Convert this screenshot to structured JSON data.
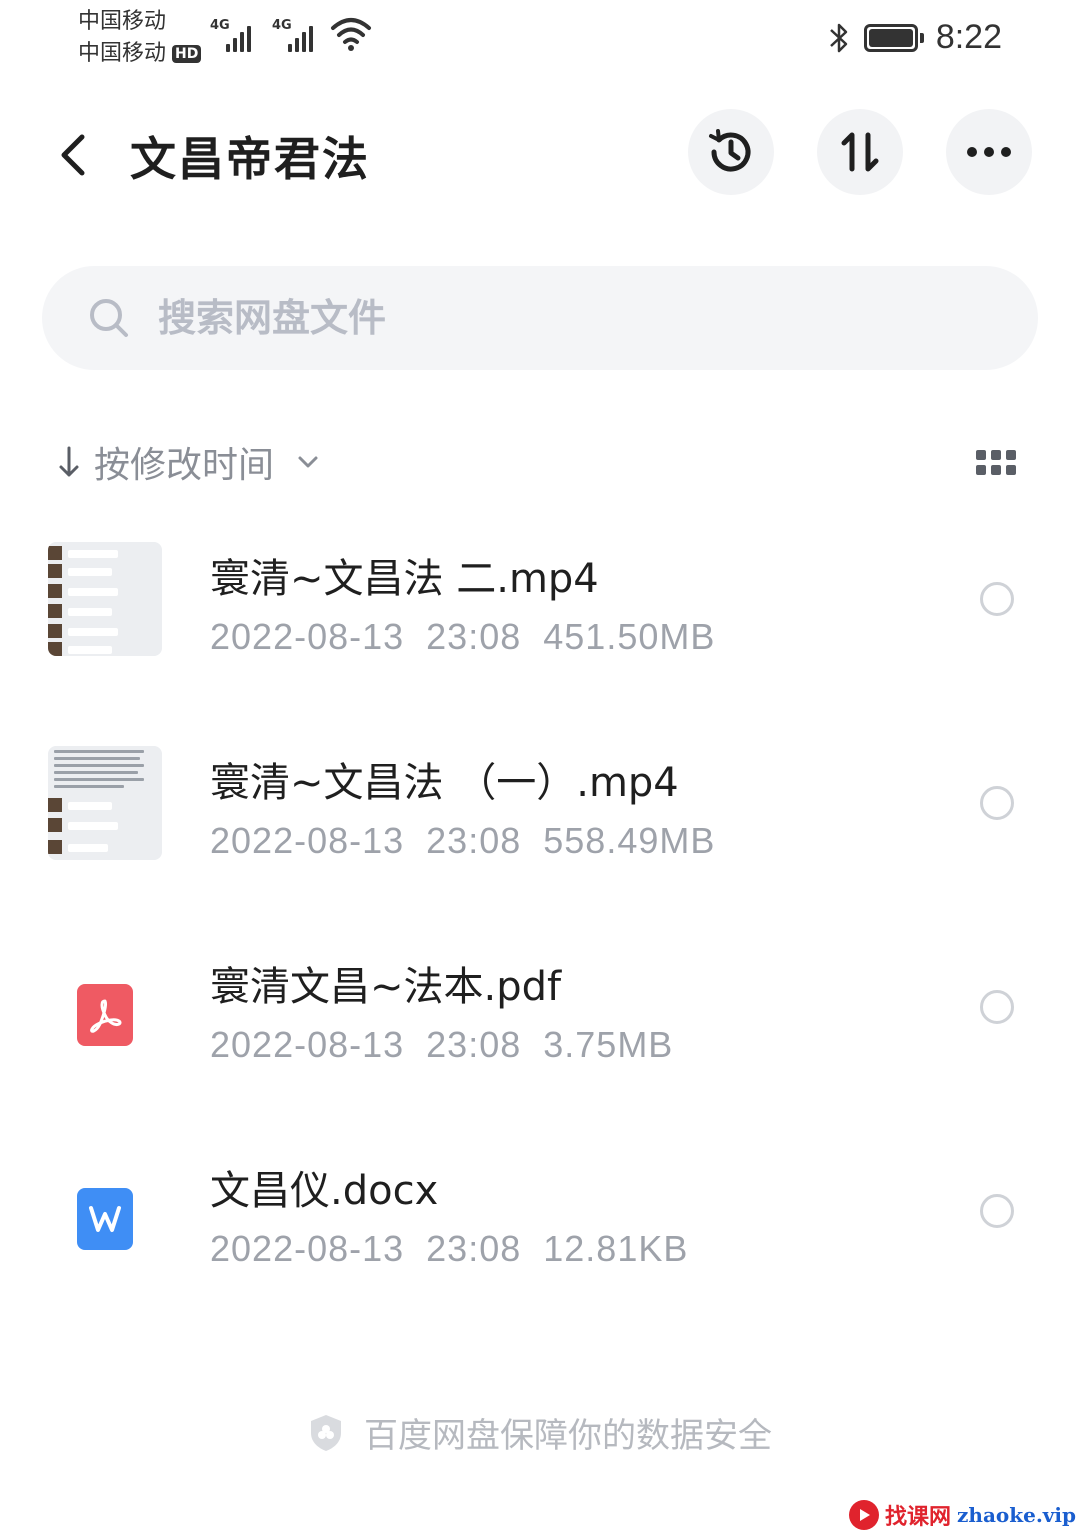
{
  "status_bar": {
    "carrier_1": "中国移动",
    "carrier_2": "中国移动",
    "hd_badge": "HD",
    "network_1": "4G",
    "network_2": "4G",
    "time": "8:22",
    "icons": [
      "signal-icon",
      "wifi-icon",
      "bluetooth-icon",
      "battery-icon"
    ]
  },
  "header": {
    "title": "文昌帝君法",
    "icons": [
      "back-arrow-icon",
      "history-icon",
      "sort-transfer-icon",
      "more-icon"
    ]
  },
  "search": {
    "placeholder": "搜索网盘文件"
  },
  "sort": {
    "label": "按修改时间",
    "icons": [
      "arrow-down-icon",
      "chevron-down-icon",
      "grid-view-icon"
    ]
  },
  "files": [
    {
      "name": "寰清~文昌法 二.mp4",
      "date": "2022-08-13",
      "time": "23:08",
      "size": "451.50MB",
      "type": "video"
    },
    {
      "name": "寰清~文昌法 （一）.mp4",
      "date": "2022-08-13",
      "time": "23:08",
      "size": "558.49MB",
      "type": "video"
    },
    {
      "name": "寰清文昌~法本.pdf",
      "date": "2022-08-13",
      "time": "23:08",
      "size": "3.75MB",
      "type": "pdf"
    },
    {
      "name": "文昌仪.docx",
      "date": "2022-08-13",
      "time": "23:08",
      "size": "12.81KB",
      "type": "word"
    }
  ],
  "footer": {
    "note": "百度网盘保障你的数据安全"
  },
  "watermark": {
    "text": "找课网",
    "url": "zhaoke.vip"
  },
  "colors": {
    "pdf": "#ef5a63",
    "word": "#3f8ef5",
    "muted_text": "#9ea2aa",
    "search_bg": "#f4f5f7"
  }
}
